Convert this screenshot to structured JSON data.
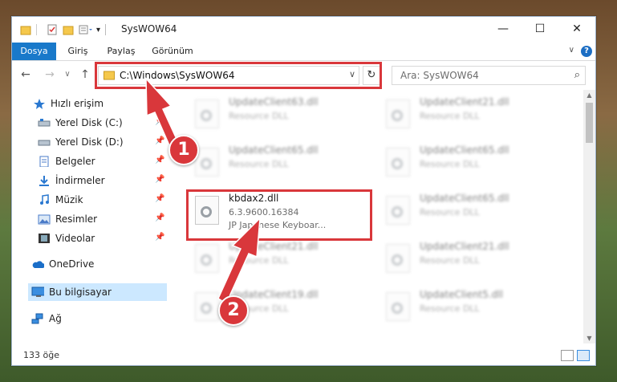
{
  "window": {
    "title": "SysWOW64",
    "minimize": "—",
    "maximize": "☐",
    "close": "✕"
  },
  "ribbon": {
    "tabs": [
      "Dosya",
      "Giriş",
      "Paylaş",
      "Görünüm"
    ],
    "help": "?"
  },
  "nav": {
    "address": "C:\\Windows\\SysWOW64",
    "search_placeholder": "Ara: SysWOW64"
  },
  "sidebar": {
    "items": [
      {
        "label": "Hızlı erişim",
        "icon": "star-icon"
      },
      {
        "label": "Yerel Disk (C:)",
        "icon": "drive-icon"
      },
      {
        "label": "Yerel Disk (D:)",
        "icon": "drive-icon"
      },
      {
        "label": "Belgeler",
        "icon": "documents-icon"
      },
      {
        "label": "İndirmeler",
        "icon": "download-icon"
      },
      {
        "label": "Müzik",
        "icon": "music-icon"
      },
      {
        "label": "Resimler",
        "icon": "pictures-icon"
      },
      {
        "label": "Videolar",
        "icon": "videos-icon"
      },
      {
        "label": "OneDrive",
        "icon": "cloud-icon"
      },
      {
        "label": "Bu bilgisayar",
        "icon": "computer-icon"
      },
      {
        "label": "Ağ",
        "icon": "network-icon"
      }
    ]
  },
  "files": {
    "left": [
      {
        "name": "UpdateClient63.dll",
        "desc": "Resource DLL"
      },
      {
        "name": "UpdateClient65.dll",
        "desc": "Resource DLL"
      },
      {
        "name": "kbdax2.dll",
        "version": "6.3.9600.16384",
        "desc": "JP Japanese Keyboar..."
      },
      {
        "name": "UpdateClient21.dll",
        "desc": "Resource DLL"
      },
      {
        "name": "UpdateClient19.dll",
        "desc": "Resource DLL"
      }
    ],
    "right": [
      {
        "name": "UpdateClient21.dll",
        "desc": "Resource DLL"
      },
      {
        "name": "UpdateClient65.dll",
        "desc": "Resource DLL"
      },
      {
        "name": "UpdateClient65.dll",
        "desc": "Resource DLL"
      },
      {
        "name": "UpdateClient21.dll",
        "desc": "Resource DLL"
      },
      {
        "name": "UpdateClient5.dll",
        "desc": "Resource DLL"
      }
    ]
  },
  "status": {
    "count": "133 öğe"
  },
  "annotations": {
    "badge1": "1",
    "badge2": "2",
    "color": "#d9373b"
  }
}
